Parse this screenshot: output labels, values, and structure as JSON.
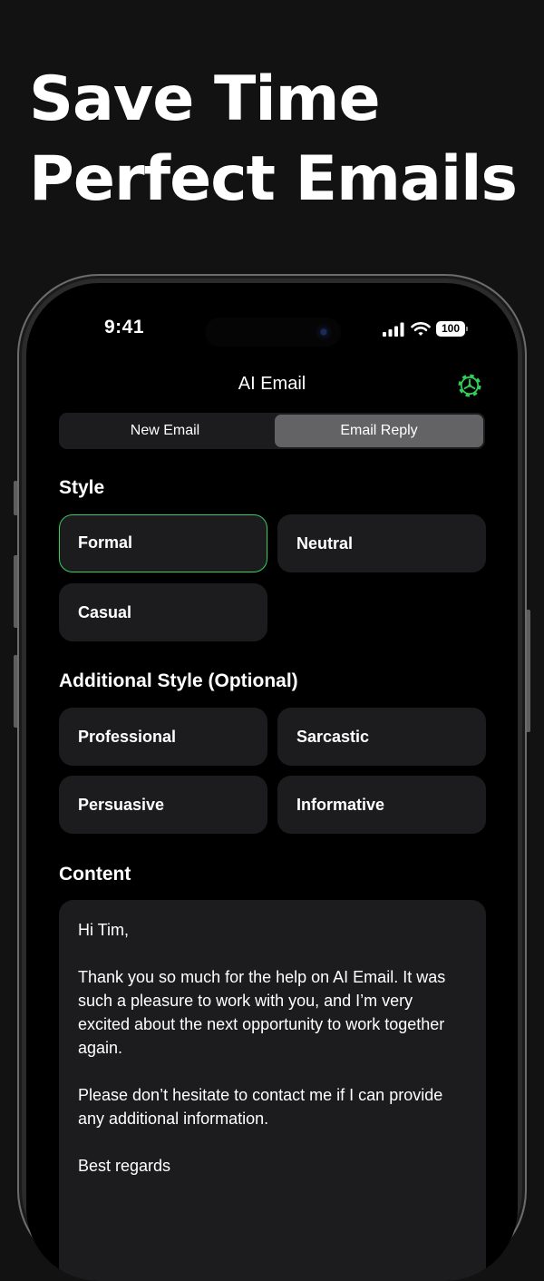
{
  "headline": {
    "line1": "Save Time",
    "line2": "Perfect Emails"
  },
  "status_bar": {
    "time": "9:41",
    "battery": "100"
  },
  "nav": {
    "title": "AI Email",
    "settings_icon": "gear-icon"
  },
  "segments": {
    "new_email": "New Email",
    "email_reply": "Email Reply",
    "selected": "Email Reply"
  },
  "style_section": {
    "label": "Style",
    "options": [
      "Formal",
      "Neutral",
      "Casual"
    ],
    "selected": "Formal"
  },
  "additional_section": {
    "label": "Additional Style (Optional)",
    "options": [
      "Professional",
      "Sarcastic",
      "Persuasive",
      "Informative"
    ]
  },
  "content_section": {
    "label": "Content",
    "text": "Hi Tim,\n\nThank you so much for the help on AI Email. It was such a pleasure to work with you, and I’m very excited about the next opportunity to work together again.\n\nPlease don’t hesitate to contact me if I can provide any additional information.\n\nBest regards"
  },
  "colors": {
    "background": "#121212",
    "accent": "#30d158",
    "card": "#1c1c1e",
    "segment_selected": "#636366"
  }
}
